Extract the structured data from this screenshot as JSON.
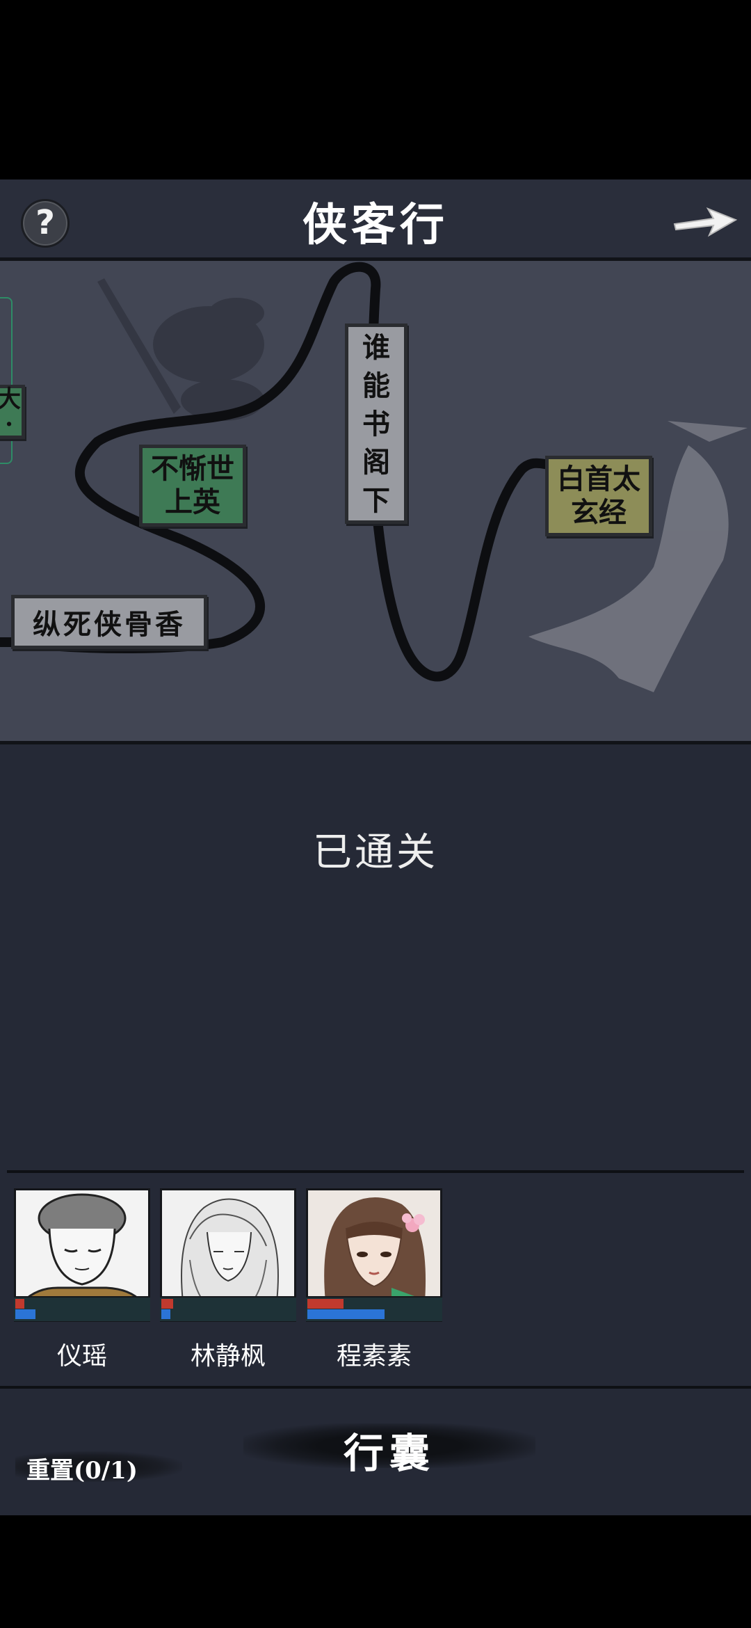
{
  "header": {
    "help_label": "?",
    "title": "侠客行"
  },
  "map": {
    "nodes": [
      {
        "id": "partial",
        "lines": [
          "大",
          "·"
        ]
      },
      {
        "id": "buxi",
        "lines": [
          "不惭世",
          "上英"
        ]
      },
      {
        "id": "shuineng",
        "lines": [
          "谁",
          "能",
          "书",
          "阁",
          "下"
        ]
      },
      {
        "id": "baishou",
        "lines": [
          "白首太",
          "玄经"
        ]
      },
      {
        "id": "zongsi",
        "lines": [
          "纵死侠骨香"
        ]
      }
    ]
  },
  "status_text": "已通关",
  "party": {
    "members": [
      {
        "name": "仪瑶",
        "hp": 0.07,
        "mp": 0.15
      },
      {
        "name": "林静枫",
        "hp": 0.09,
        "mp": 0.07
      },
      {
        "name": "程素素",
        "hp": 0.27,
        "mp": 0.58
      }
    ]
  },
  "footer": {
    "reset_label": "重置(0/1)",
    "bag_label": "行囊"
  },
  "colors": {
    "node_green": "#3e7a55",
    "node_gray": "#999ba1",
    "node_olive": "#8d8d58",
    "hp_bar": "#c13a2e",
    "mp_bar": "#2b74d6"
  }
}
